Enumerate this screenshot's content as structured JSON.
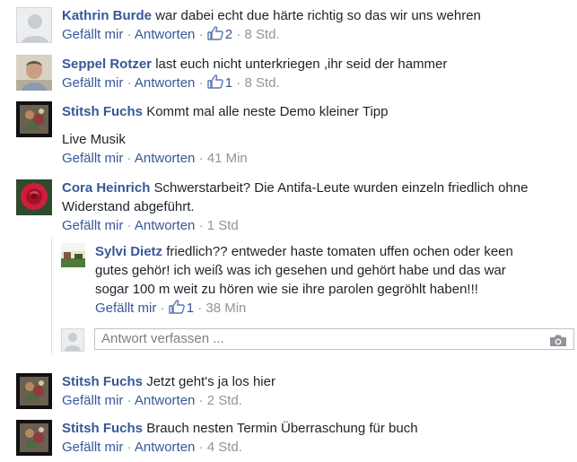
{
  "labels": {
    "like": "Gefällt mir",
    "reply": "Antworten",
    "sep": "·"
  },
  "reply_placeholder": "Antwort verfassen ...",
  "comments": [
    {
      "name": "Kathrin Burde",
      "text": "war dabei echt due härte richtig so das wir uns wehren",
      "likes": "2",
      "time": "8 Std.",
      "avatar": "default-silhouette"
    },
    {
      "name": "Seppel Rotzer",
      "text": "last euch nicht unterkriegen ,ihr seid der hammer",
      "likes": "1",
      "time": "8 Std.",
      "avatar": "photo-person"
    },
    {
      "name": "Stitsh Fuchs",
      "text": "Kommt mal alle neste Demo kleiner Tipp",
      "extra": "Live Musik",
      "time": "41 Min",
      "avatar": "framed-picture"
    },
    {
      "name": "Cora Heinrich",
      "text": "Schwerstarbeit? Die Antifa-Leute wurden einzeln friedlich ohne Widerstand abgeführt.",
      "time": "1 Std",
      "avatar": "red-rose"
    },
    {
      "name": "Stitsh Fuchs",
      "text": "Jetzt geht's ja los hier",
      "time": "2 Std.",
      "avatar": "framed-picture"
    },
    {
      "name": "Stitsh Fuchs",
      "text": "Brauch nesten Termin Überraschung für buch",
      "time": "4 Std.",
      "avatar": "framed-picture"
    }
  ],
  "reply": {
    "name": "Sylvi Dietz",
    "text": "friedlich?? entweder haste tomaten uffen ochen oder keen gutes gehör! ich weiß was ich gesehen und gehört habe und das war sogar 100 m weit zu hören wie sie ihre parolen gegröhlt haben!!!",
    "likes": "1",
    "time": "38 Min",
    "avatar": "photo-landscape"
  },
  "colors": {
    "link": "#365899",
    "meta": "#90949c",
    "text": "#1d2129"
  }
}
